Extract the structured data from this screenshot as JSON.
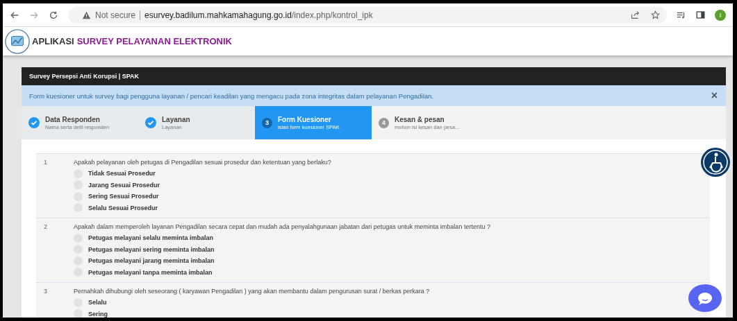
{
  "browser": {
    "security": "Not secure",
    "url_host": "esurvey.badilum.mahkamahagung.go.id",
    "url_path": "/index.php/kontrol_ipk",
    "profile_initial": "I"
  },
  "app_header": {
    "prefix": "APLIKASI",
    "title": "SURVEY PELAYANAN ELEKTRONIK"
  },
  "card": {
    "title": "Survey Persepsi Anti Korupsi | SPAK",
    "alert": {
      "text": "Form kuesioner untuk survey bagi pengguna layanan / pencari keadilan yang mengacu pada zona integritas dalam pelayanan Pengadilan.",
      "close": "×"
    },
    "steps": [
      {
        "title": "Data Responden",
        "subtitle": "Nama serta detil responden",
        "done": true,
        "selected": false
      },
      {
        "title": "Layanan",
        "subtitle": "Layanan",
        "done": true,
        "selected": false
      },
      {
        "number": "3",
        "title": "Form Kuesioner",
        "subtitle": "isian form kuesioner SPAK",
        "done": false,
        "selected": true
      },
      {
        "number": "4",
        "title": "Kesan & pesan",
        "subtitle": "mohon isi kesan dan pesa...",
        "done": false,
        "selected": false
      }
    ],
    "questions": [
      {
        "number": "1",
        "text": "Apakah pelayanan oleh petugas di Pengadilan sesuai prosedur dan ketentuan yang berlaku?",
        "options": [
          {
            "label": "Tidak Sesuai Prosedur",
            "selected": false
          },
          {
            "label": "Jarang Sesuai Prosedur",
            "selected": false
          },
          {
            "label": "Sering Sesuai Prosedur",
            "selected": false
          },
          {
            "label": "Selalu Sesuai Prosedur",
            "selected": false
          }
        ]
      },
      {
        "number": "2",
        "text": "Apakah dalam memperoleh layanan Pengadilan secara cepat dan mudah ada penyalahgunaan jabatan dari petugas untuk meminta imbalan tertentu ?",
        "options": [
          {
            "label": "Petugas melayani selalu meminta imbalan",
            "selected": false
          },
          {
            "label": "Petugas melayani sering meminta imbalan",
            "selected": false
          },
          {
            "label": "Petugas melayani jarang meminta imbalan",
            "selected": false
          },
          {
            "label": "Petugas melayani tanpa meminta imbalan",
            "selected": false
          }
        ]
      },
      {
        "number": "3",
        "text": "Pernahkah dihubungi oleh seseorang ( karyawan Pengadilan ) yang akan membantu dalam pengurusan surat / berkas perkara ?",
        "options": [
          {
            "label": "Selalu",
            "selected": false
          },
          {
            "label": "Sering",
            "selected": false
          }
        ]
      }
    ]
  }
}
